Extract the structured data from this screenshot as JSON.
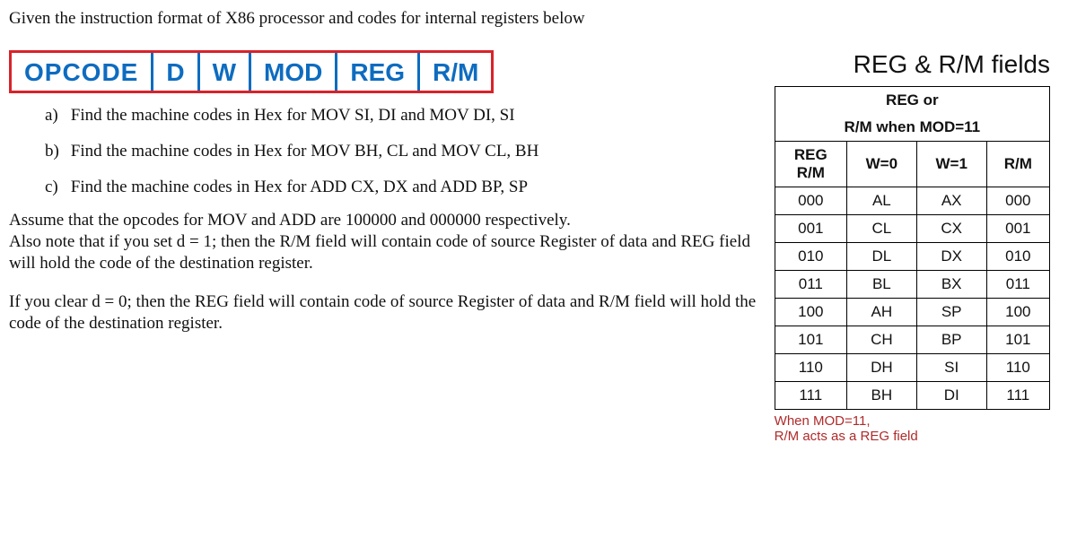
{
  "title": "Given the instruction format of X86 processor and codes for internal registers below",
  "format": {
    "segments": [
      "OPCODE",
      "D",
      "W",
      "MOD",
      "REG",
      "R/M"
    ]
  },
  "questions": {
    "a_label": "a)",
    "a": "Find the machine codes in Hex for MOV SI, DI and MOV DI, SI",
    "b_label": "b)",
    "b": "Find the machine codes in Hex for MOV BH, CL and MOV CL, BH",
    "c_label": "c)",
    "c": "Find the machine codes in Hex for ADD CX, DX and ADD BP, SP"
  },
  "para1": "Assume that the opcodes for MOV and ADD are 100000 and 000000 respectively.",
  "para2": "Also note that if you set d = 1; then the R/M field will contain code of source Register of data and REG field will hold the code of the destination register.",
  "para3": "If you clear d = 0; then the REG field will contain code of source Register of data and R/M field will hold the code of the destination register.",
  "table": {
    "title": "REG & R/M fields",
    "heading_top": "REG or",
    "heading_bottom": "R/M when MOD=11",
    "col1a": "REG",
    "col1b": "R/M",
    "col2": "W=0",
    "col3": "W=1",
    "col4": "R/M",
    "rows": [
      {
        "c1": "000",
        "c2": "AL",
        "c3": "AX",
        "c4": "000"
      },
      {
        "c1": "001",
        "c2": "CL",
        "c3": "CX",
        "c4": "001"
      },
      {
        "c1": "010",
        "c2": "DL",
        "c3": "DX",
        "c4": "010"
      },
      {
        "c1": "011",
        "c2": "BL",
        "c3": "BX",
        "c4": "011"
      },
      {
        "c1": "100",
        "c2": "AH",
        "c3": "SP",
        "c4": "100"
      },
      {
        "c1": "101",
        "c2": "CH",
        "c3": "BP",
        "c4": "101"
      },
      {
        "c1": "110",
        "c2": "DH",
        "c3": "SI",
        "c4": "110"
      },
      {
        "c1": "111",
        "c2": "BH",
        "c3": "DI",
        "c4": "111"
      }
    ],
    "footer1": "When MOD=11,",
    "footer2": "R/M acts as a REG field"
  }
}
